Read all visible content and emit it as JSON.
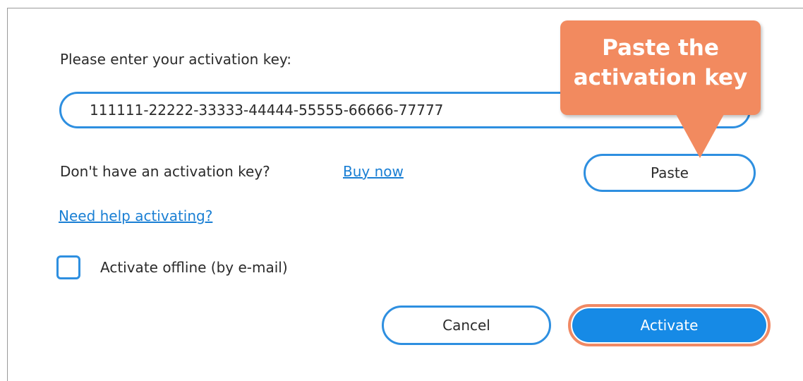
{
  "dialog": {
    "prompt": "Please enter your activation key:",
    "key_value": "111111-22222-33333-44444-55555-66666-77777",
    "no_key_text": "Don't have an activation key?",
    "buy_now_link": "Buy now",
    "help_link": "Need help activating?",
    "offline_checkbox_label": "Activate offline (by e-mail)",
    "offline_checked": false,
    "paste_button": "Paste",
    "cancel_button": "Cancel",
    "activate_button": "Activate"
  },
  "callout": {
    "line1": "Paste the",
    "line2": "activation key"
  },
  "colors": {
    "accent_blue": "#2e8fe0",
    "primary_button": "#168ae6",
    "callout_orange": "#f28a5f",
    "link": "#1a7fd4"
  }
}
